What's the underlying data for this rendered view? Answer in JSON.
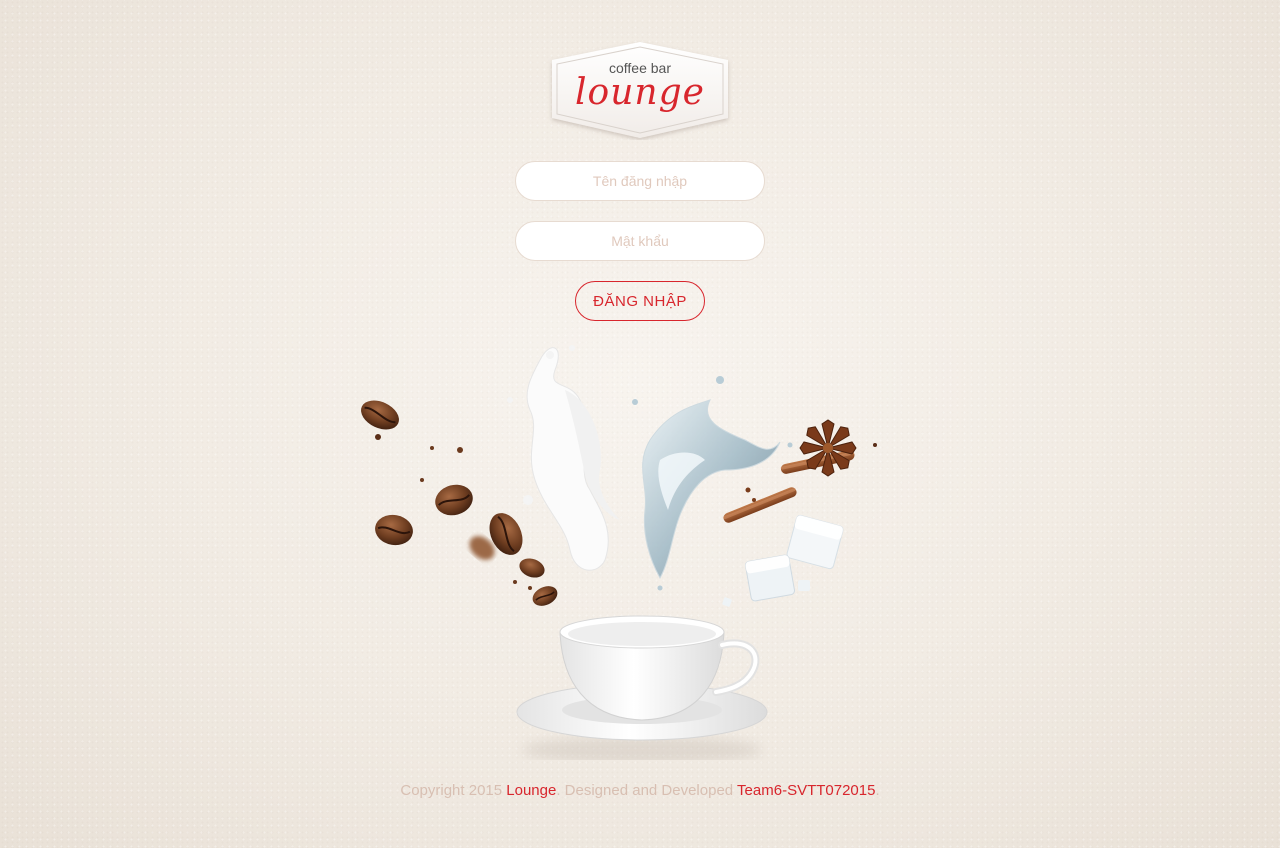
{
  "logo": {
    "small_text": "coffee bar",
    "brand_text": "lounge"
  },
  "form": {
    "username_placeholder": "Tên đăng nhập",
    "password_placeholder": "Mật khẩu",
    "login_label": "ĐĂNG NHẬP"
  },
  "illustration": {
    "icons": [
      "coffee-cup-icon",
      "coffee-bean-icon",
      "milk-splash-icon",
      "water-splash-icon",
      "cinnamon-stick-icon",
      "star-anise-icon",
      "sugar-cube-icon"
    ]
  },
  "footer": {
    "copyright_prefix": "Copyright 2015 ",
    "brand_link": "Lounge",
    "middle_text": ". Designed and Developed ",
    "team_link": "Team6-SVTT072015",
    "suffix": "."
  },
  "colors": {
    "accent": "#d8262d",
    "background": "#f3ede5",
    "muted_text": "#d8bfb2"
  }
}
